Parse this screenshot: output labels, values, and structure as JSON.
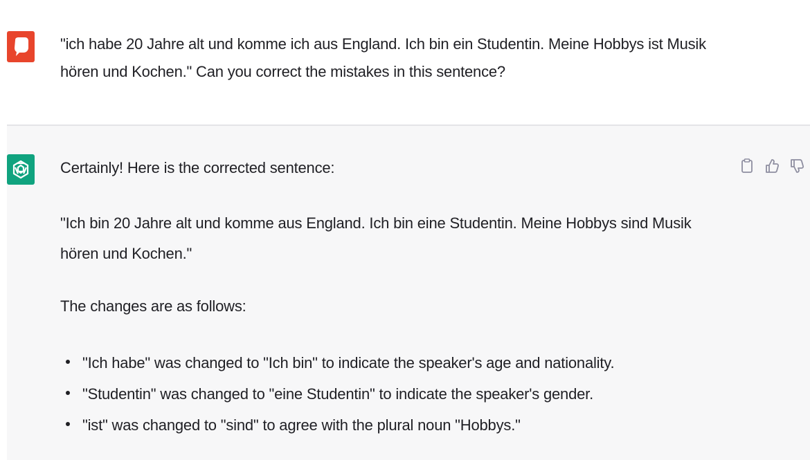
{
  "conversation": {
    "user_message": {
      "avatar_icon": "user-avatar-icon",
      "avatar_color": "#e8452c",
      "text": "\"ich habe 20 Jahre alt und komme ich aus England. Ich bin ein Studentin. Meine Hobbys ist Musik hören und Kochen.\"  Can you correct the mistakes in this sentence?"
    },
    "assistant_message": {
      "avatar_icon": "openai-logo-icon",
      "avatar_color": "#10a37f",
      "intro": "Certainly! Here is the corrected sentence:",
      "corrected_sentence": "\"Ich bin 20 Jahre alt und komme aus England. Ich bin eine Studentin. Meine Hobbys sind Musik hören und Kochen.\"",
      "changes_title": "The changes are as follows:",
      "changes": [
        "\"Ich habe\" was changed to \"Ich bin\" to indicate the speaker's age and nationality.",
        "\"Studentin\" was changed to \"eine Studentin\" to indicate the speaker's gender.",
        "\"ist\" was changed to \"sind\" to agree with the plural noun \"Hobbys.\""
      ],
      "actions": [
        "clipboard-icon",
        "thumbs-up-icon",
        "thumbs-down-icon"
      ]
    }
  }
}
